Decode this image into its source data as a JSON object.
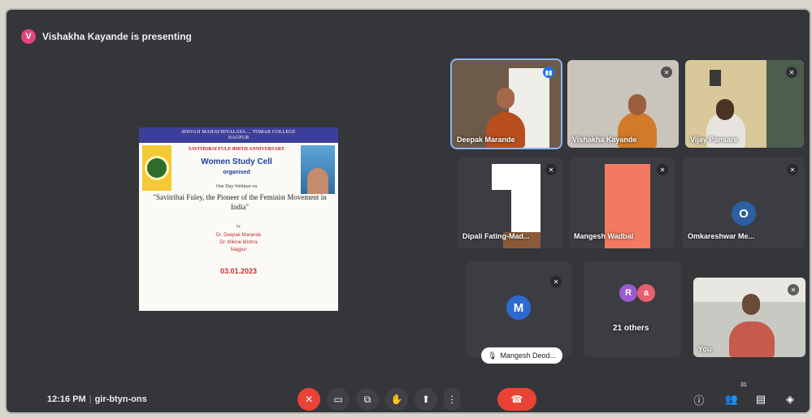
{
  "presenter": {
    "initial": "V",
    "text": "Vishakha Kayande is presenting",
    "avatar_color": "#e1447a"
  },
  "caption": "",
  "slide": {
    "header": "SHIVAJI MAHAVIDYALAYA ... TOMAR COLLEGE",
    "header_sub": "NAGPUR",
    "anniversary": "SAVITRIBAI FULE BIRTH ANNIVERSARY",
    "cell": "Women Study Cell",
    "organised": "organised",
    "webinar": "One Day Webinar on",
    "topic": "\"Savitribai Fuley, the Pioneer of the Feminist Movement in India\"",
    "by": "by",
    "speakers": [
      "Dr. Deepak Marande",
      "Dr. Mikine Mishra",
      "Nagpur"
    ],
    "date": "03.01.2023"
  },
  "tiles": [
    {
      "name": "Deepak Marande",
      "mic": "talking"
    },
    {
      "name": "Vishakha Kayande",
      "mic": "muted"
    },
    {
      "name": "Vijay Pansare",
      "mic": "muted"
    },
    {
      "name": "Dipali Fating-Mad...",
      "mic": "muted"
    },
    {
      "name": "Mangesh Wadbal",
      "mic": "muted"
    },
    {
      "name": "Omkareshwar Me...",
      "initial": "O",
      "mic": "muted"
    },
    {
      "name": "Mangesh Deod...",
      "initial": "M",
      "mic": "muted"
    },
    {
      "name": "21 others",
      "initials": [
        "R",
        "a"
      ]
    },
    {
      "name": "You",
      "mic": "muted"
    }
  ],
  "bottom": {
    "time": "12:16 PM",
    "separator": "|",
    "meeting_code": "gir-btyn-ons",
    "people_count": "31"
  },
  "controls": {
    "mic": "mic-off-icon",
    "camera": "camera-icon",
    "captions": "captions-icon",
    "hand": "raise-hand-icon",
    "present": "present-icon",
    "more": "more-options-icon",
    "end": "end-call-icon"
  },
  "colors": {
    "accent_red": "#ea4335",
    "accent_blue": "#1a73e8",
    "bg": "#34363a"
  }
}
